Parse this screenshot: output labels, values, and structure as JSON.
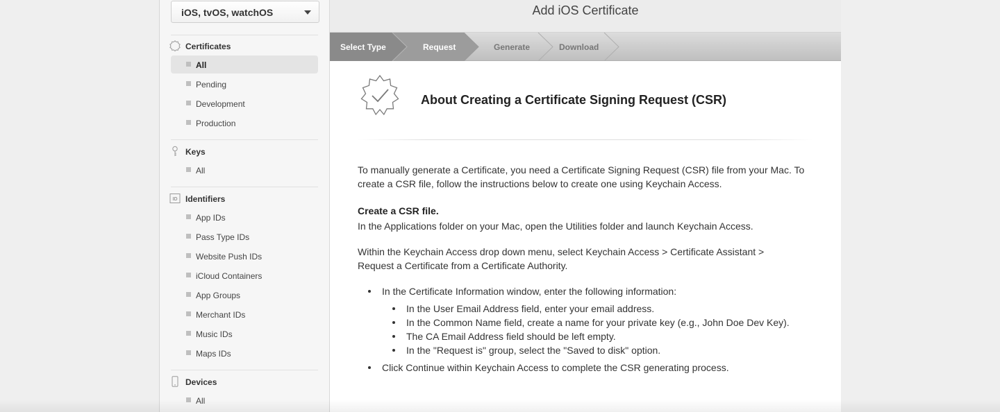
{
  "sidebar": {
    "platform": "iOS, tvOS, watchOS",
    "sections": [
      {
        "title": "Certificates",
        "icon": "certificate-icon",
        "items": [
          "All",
          "Pending",
          "Development",
          "Production"
        ]
      },
      {
        "title": "Keys",
        "icon": "key-icon",
        "items": [
          "All"
        ]
      },
      {
        "title": "Identifiers",
        "icon": "id-icon",
        "items": [
          "App IDs",
          "Pass Type IDs",
          "Website Push IDs",
          "iCloud Containers",
          "App Groups",
          "Merchant IDs",
          "Music IDs",
          "Maps IDs"
        ]
      },
      {
        "title": "Devices",
        "icon": "device-icon",
        "items": [
          "All"
        ]
      }
    ],
    "active_item": "Certificates / All"
  },
  "main": {
    "title": "Add iOS Certificate",
    "steps": [
      "Select Type",
      "Request",
      "Generate",
      "Download"
    ],
    "about_title": "About Creating a Certificate Signing Request (CSR)",
    "intro": "To manually generate a Certificate, you need a Certificate Signing Request (CSR) file from your Mac. To create a CSR file, follow the instructions below to create one using Keychain Access.",
    "create_heading": "Create a CSR file.",
    "create_text": "In the Applications folder on your Mac, open the Utilities folder and launch Keychain Access.",
    "within_text": "Within the Keychain Access drop down menu, select Keychain Access > Certificate Assistant > Request a Certificate from a Certificate Authority.",
    "bullet1": "In the Certificate Information window, enter the following information:",
    "sub_bullets": [
      "In the User Email Address field, enter your email address.",
      "In the Common Name field, create a name for your private key (e.g., John Doe Dev Key).",
      "The CA Email Address field should be left empty.",
      "In the \"Request is\" group, select the \"Saved to disk\" option."
    ],
    "bullet2": "Click Continue within Keychain Access to complete the CSR generating process."
  },
  "colors": {
    "step_done": "#8a8a8a",
    "step_pending": "#cfcfcf",
    "sidebar_bg": "#f6f6f6",
    "active_item_bg": "#e4e4e4"
  }
}
